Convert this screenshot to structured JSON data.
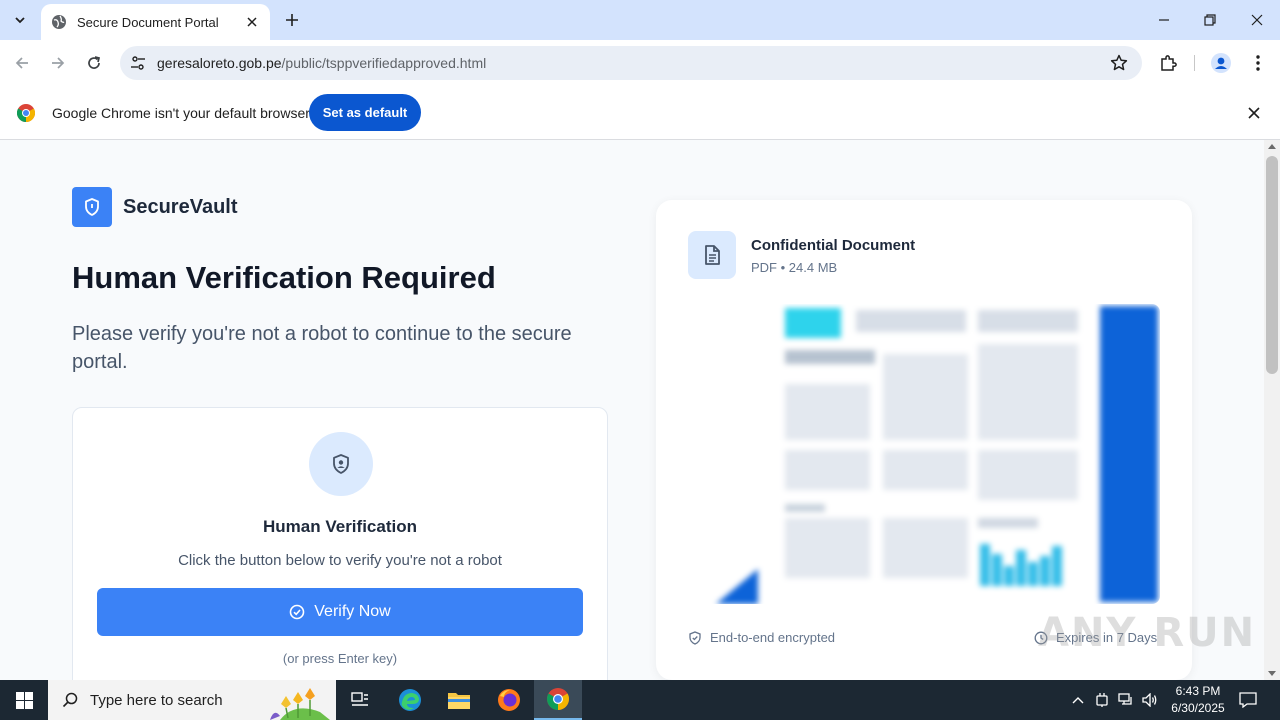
{
  "browser": {
    "tab": {
      "title": "Secure Document Portal"
    },
    "url": {
      "domain": "geresaloreto.gob.pe",
      "path": "/public/tsppverifiedapproved.html"
    }
  },
  "infobar": {
    "message": "Google Chrome isn't your default browser",
    "button": "Set as default"
  },
  "page": {
    "brand": "SecureVault",
    "headline": "Human Verification Required",
    "subtext": "Please verify you're not a robot to continue to the secure portal.",
    "verify_card": {
      "title": "Human Verification",
      "description": "Click the button below to verify you're not a robot",
      "button": "Verify Now",
      "hint": "(or press Enter key)"
    },
    "document": {
      "name": "Confidential Document",
      "meta": "PDF • 24.4 MB",
      "footer_left": "End-to-end encrypted",
      "footer_right": "Expires in 7 Days"
    },
    "watermark": "ANY RUN"
  },
  "taskbar": {
    "search_placeholder": "Type here to search",
    "time": "6:43 PM",
    "date": "6/30/2025"
  },
  "colors": {
    "primary": "#3b82f6",
    "chrome_blue": "#0b57d0",
    "tab_strip": "#d3e3fd"
  }
}
